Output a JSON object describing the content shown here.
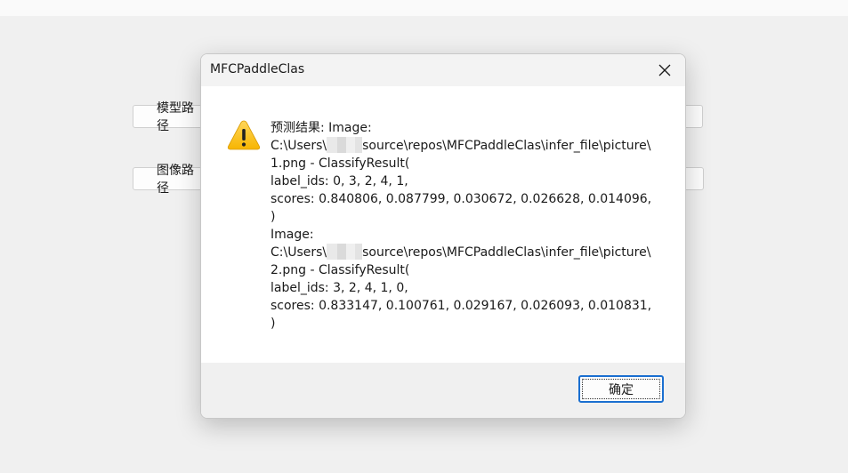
{
  "background_app": {
    "model_path_button": "模型路径",
    "image_path_button": "图像路径"
  },
  "dialog": {
    "title": "MFCPaddleClas",
    "close_icon": "close-icon",
    "warning_icon": "warning-icon",
    "message_lines": [
      "预测结果: Image:",
      "C:\\Users\\",
      "source\\repos\\MFCPaddleClas\\infer_file\\picture\\",
      "1.png - ClassifyResult(",
      "label_ids: 0, 3, 2, 4, 1,",
      "scores: 0.840806, 0.087799, 0.030672, 0.026628, 0.014096,",
      ")",
      "Image:",
      "C:\\Users\\",
      "source\\repos\\MFCPaddleClas\\infer_file\\picture\\",
      "2.png - ClassifyResult(",
      "label_ids: 3, 2, 4, 1, 0,",
      "scores: 0.833147, 0.100761, 0.029167, 0.026093, 0.010831,",
      ")"
    ],
    "ok_button": "确定"
  },
  "colors": {
    "warning_yellow": "#ffc83d",
    "focus_blue": "#1a6fd0"
  }
}
